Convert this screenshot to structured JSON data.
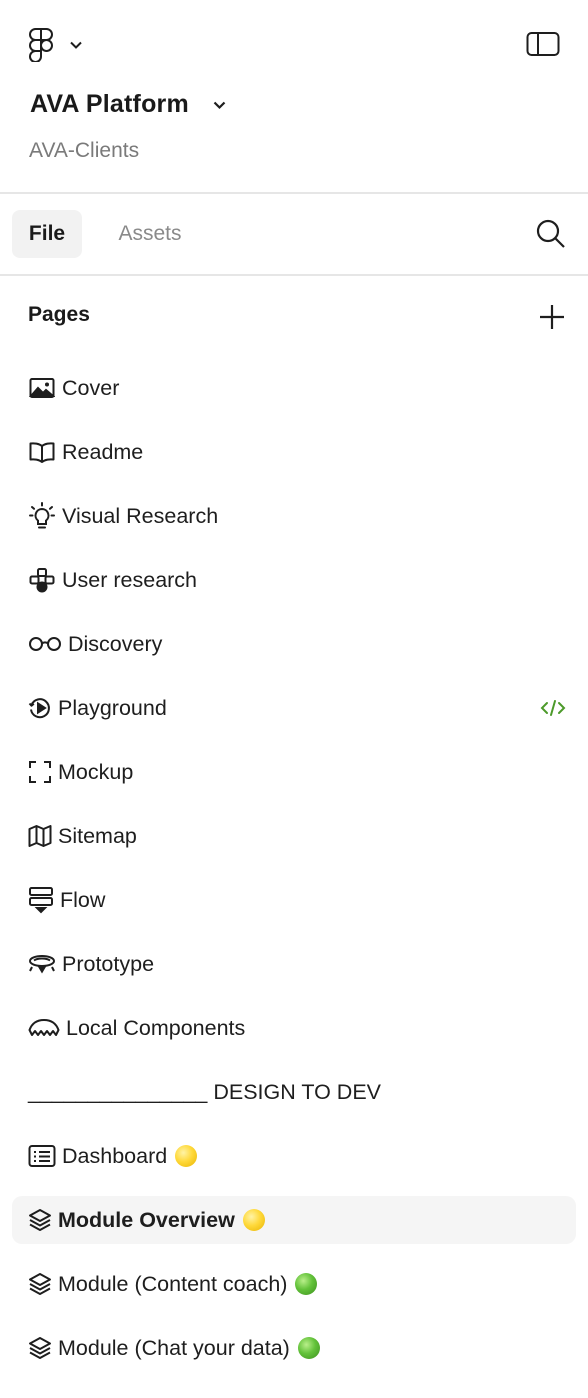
{
  "header": {
    "project_title": "AVA Platform",
    "team_name": "AVA-Clients"
  },
  "tabs": [
    {
      "label": "File",
      "active": true
    },
    {
      "label": "Assets",
      "active": false
    }
  ],
  "pages_section": {
    "heading": "Pages",
    "items": [
      {
        "label": "Cover",
        "icon": "image-icon"
      },
      {
        "label": "Readme",
        "icon": "book-icon"
      },
      {
        "label": "Visual Research",
        "icon": "lightbulb-icon"
      },
      {
        "label": "User research",
        "icon": "gamepad-icon"
      },
      {
        "label": "Discovery",
        "icon": "glasses-icon"
      },
      {
        "label": "Playground",
        "icon": "play-history-icon",
        "badge": "dev-mode-icon"
      },
      {
        "label": "Mockup",
        "icon": "frame-corners-icon"
      },
      {
        "label": "Sitemap",
        "icon": "map-icon"
      },
      {
        "label": "Flow",
        "icon": "flow-icon"
      },
      {
        "label": "Prototype",
        "icon": "hovercraft-icon"
      },
      {
        "label": "Local Components",
        "icon": "component-icon"
      },
      {
        "label": "_______________ DESIGN TO DEV",
        "icon": ""
      },
      {
        "label": "Dashboard",
        "icon": "list-window-icon",
        "status": "yellow"
      },
      {
        "label": "Module Overview",
        "icon": "layers-icon",
        "status": "yellow",
        "active": true
      },
      {
        "label": "Module (Content coach)",
        "icon": "layers-icon",
        "status": "green"
      },
      {
        "label": "Module (Chat your data)",
        "icon": "layers-icon",
        "status": "green"
      }
    ]
  },
  "colors": {
    "active_row_bg": "#f5f5f5",
    "dev_badge": "#4c9a2a",
    "status_yellow": "#ffd93b",
    "status_green": "#63c23a",
    "muted_text": "#7a7a7a"
  }
}
